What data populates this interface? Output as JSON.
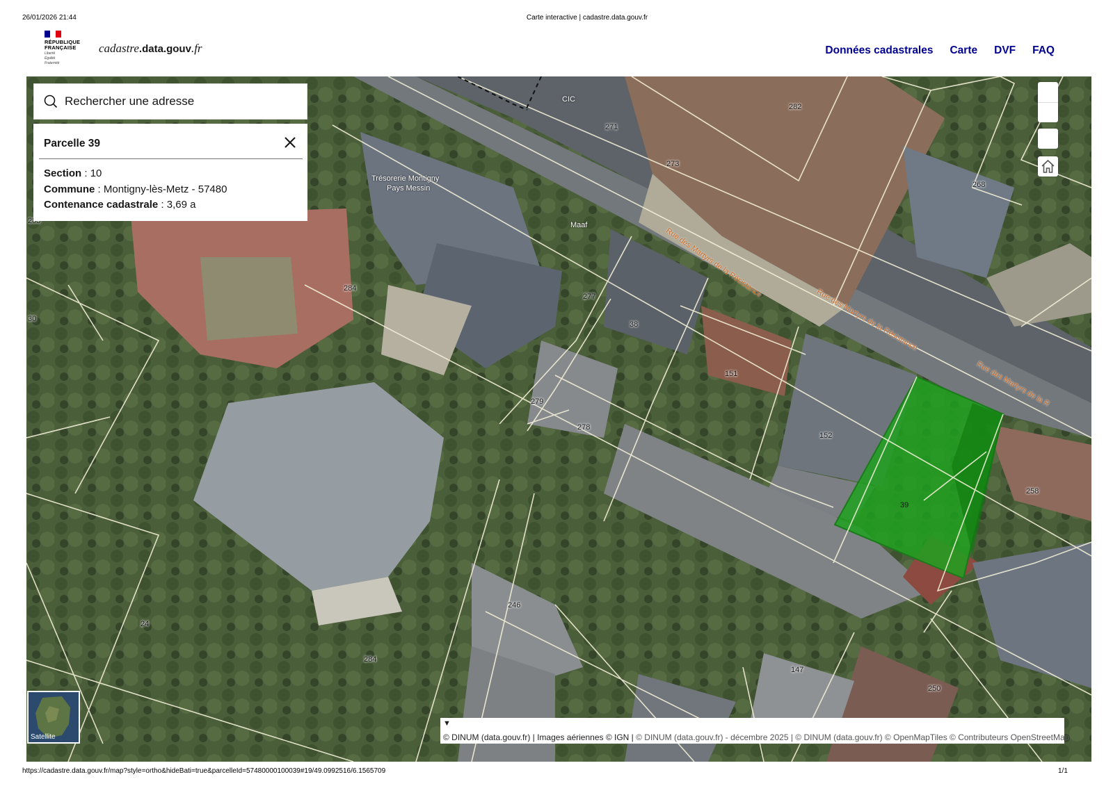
{
  "print_header": {
    "datetime": "26/01/2026 21:44",
    "page_title": "Carte interactive | cadastre.data.gouv.fr"
  },
  "print_footer": {
    "url": "https://cadastre.data.gouv.fr/map?style=ortho&hideBati=true&parcelleId=57480000100039#19/49.0992516/6.1565709",
    "page": "1/1"
  },
  "header": {
    "logo": {
      "line1": "RÉPUBLIQUE",
      "line2": "FRANÇAISE",
      "motto1": "Liberté",
      "motto2": "Égalité",
      "motto3": "Fraternité"
    },
    "brand": {
      "prefix": "cadastre",
      "middle": ".data.gouv",
      "suffix": ".fr"
    },
    "nav": [
      "Données cadastrales",
      "Carte",
      "DVF",
      "FAQ"
    ]
  },
  "search": {
    "placeholder": "Rechercher une adresse"
  },
  "parcel_panel": {
    "title": "Parcelle 39",
    "rows": [
      {
        "label": "Section",
        "value": "10"
      },
      {
        "label": "Commune",
        "value": "Montigny-lès-Metz - 57480"
      },
      {
        "label": "Contenance cadastrale",
        "value": "3,69 a"
      }
    ]
  },
  "map": {
    "style": "Satellite",
    "selected_parcel": "39",
    "parcel_labels": [
      "282",
      "271",
      "273",
      "268",
      "283",
      "30",
      "284",
      "277",
      "38",
      "151",
      "279",
      "278",
      "152",
      "39",
      "258",
      "246",
      "24",
      "284",
      "147",
      "250"
    ],
    "place_labels": [
      "CIC",
      "Trésorerie Montigny",
      "Pays Messin",
      "Maaf"
    ],
    "street_labels": [
      "Rue des Martyrs de la Résistance",
      "Rue des Martyrs de la Résistance",
      "Rue des Martyrs de la R"
    ],
    "colors": {
      "selection_fill": "#1fa11f",
      "nav_link": "#000091",
      "parcel_lines": "#f3efd8"
    }
  },
  "minimap": {
    "label": "Satellite"
  },
  "attribution": {
    "toggle": "▼",
    "part1": "© DINUM (data.gouv.fr) | Images aériennes © IGN | ",
    "part2": "© DINUM (data.gouv.fr) - décembre 2025 | © DINUM (data.gouv.fr) © OpenMapTiles © Contributeurs OpenStreetMap"
  }
}
